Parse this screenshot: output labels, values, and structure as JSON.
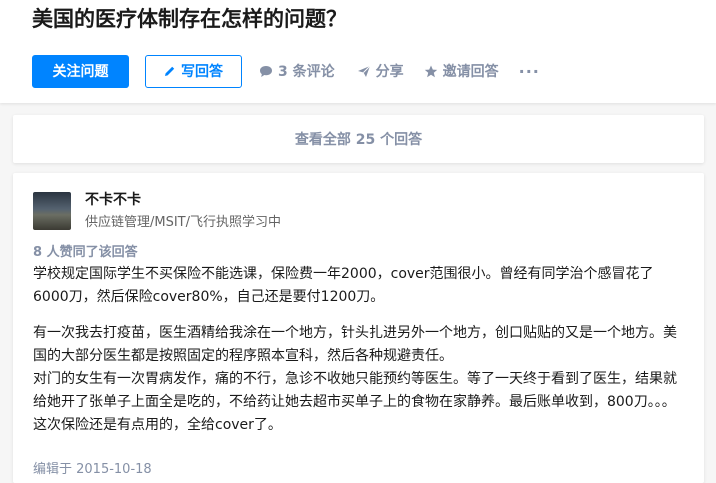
{
  "question": {
    "title": "美国的医疗体制存在怎样的问题？",
    "follow_label": "关注问题",
    "write_label": "写回答",
    "comments_label": "3 条评论",
    "share_label": "分享",
    "invite_label": "邀请回答",
    "more_label": "···"
  },
  "answers_summary": {
    "view_all_label": "查看全部 25 个回答"
  },
  "answer": {
    "author_name": "不卡不卡",
    "author_bio": "供应链管理/MSIT/飞行执照学习中",
    "vote_info": "8 人赞同了该回答",
    "paragraphs": [
      "学校规定国际学生不买保险不能选课，保险费一年2000，cover范围很小。曾经有同学治个感冒花了6000刀，然后保险cover80%，自己还是要付1200刀。",
      "有一次我去打疫苗，医生酒精给我涂在一个地方，针头扎进另外一个地方，创口贴贴的又是一个地方。美国的大部分医生都是按照固定的程序照本宣科，然后各种规避责任。",
      "对门的女生有一次胃病发作，痛的不行，急诊不收她只能预约等医生。等了一天终于看到了医生，结果就给她开了张单子上面全是吃的，不给药让她去超市买单子上的食物在家静养。最后账单收到，800刀。。。这次保险还是有点用的，全给cover了。"
    ],
    "edit_date": "编辑于 2015-10-18"
  },
  "colors": {
    "brand_blue": "#0084ff",
    "meta_gray": "#8590a6",
    "page_bg": "#f6f6f6"
  },
  "icons": {
    "write": "pencil-icon",
    "comments": "comment-bubble-icon",
    "share": "paper-plane-icon",
    "invite": "star-icon"
  }
}
